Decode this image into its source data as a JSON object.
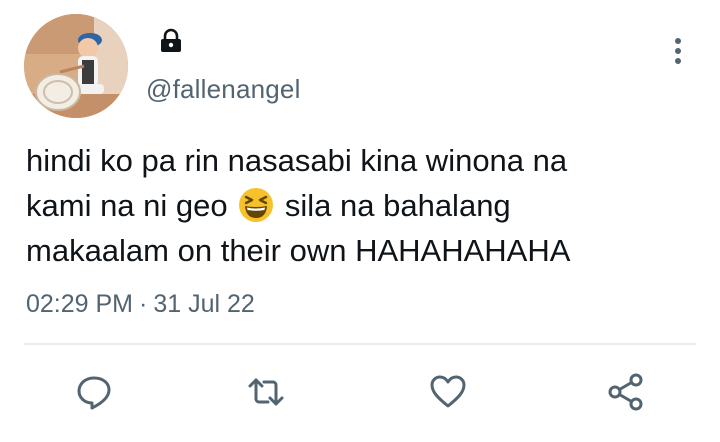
{
  "tweet": {
    "handle": "@fallenangel",
    "lines": [
      "hindi ko pa rin nasasabi kina winona na",
      "kami na ni geo",
      "sila na bahalang",
      "makaalam on their own HAHAHAHAHA"
    ],
    "emoji": "grinning-squinting-face",
    "time": "02:29 PM",
    "separator": "·",
    "date": "31 Jul 22",
    "protected": true
  },
  "icons": {
    "lock": "lock-icon",
    "more": "more-vertical-icon",
    "reply": "reply-icon",
    "retweet": "retweet-icon",
    "like": "heart-icon",
    "share": "share-icon"
  },
  "colors": {
    "text": "#0f1419",
    "secondary": "#536471",
    "icon": "#536471",
    "divider": "#e6ecf0",
    "emoji_face": "#f6c22c"
  }
}
